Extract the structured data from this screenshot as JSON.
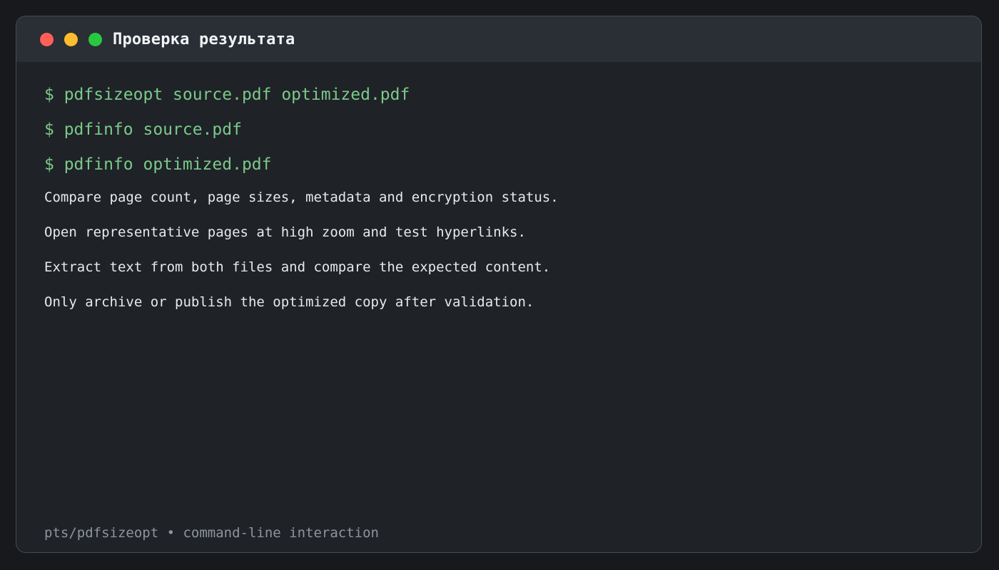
{
  "window": {
    "title": "Проверка результата",
    "controls": [
      {
        "name": "close",
        "color": "#ff5f57"
      },
      {
        "name": "minimize",
        "color": "#febc2e"
      },
      {
        "name": "maximize",
        "color": "#28c840"
      }
    ]
  },
  "commands": [
    "$ pdfsizeopt source.pdf optimized.pdf",
    "$ pdfinfo source.pdf",
    "$ pdfinfo optimized.pdf"
  ],
  "notes": [
    "Compare page count, page sizes, metadata and encryption status.",
    "Open representative pages at high zoom and test hyperlinks.",
    "Extract text from both files and compare the expected content.",
    "Only archive or publish the optimized copy after validation."
  ],
  "footer": "pts/pdfsizeopt • command-line interaction",
  "colors": {
    "command": "#7bc98a",
    "note": "#e8e9eb",
    "footer": "#8f949c",
    "background": "#1f2227",
    "titlebar": "#2a2e35"
  }
}
